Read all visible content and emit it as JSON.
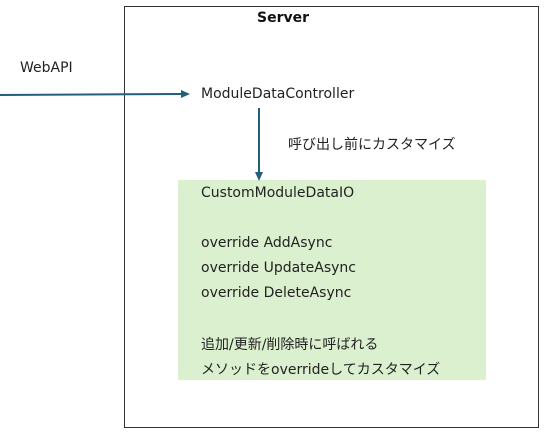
{
  "server": {
    "title": "Server"
  },
  "webapi": {
    "label": "WebAPI"
  },
  "controller": {
    "label": "ModuleDataController"
  },
  "customize_note": {
    "label": "呼び出し前にカスタマイズ"
  },
  "custom_box": {
    "class_name": "CustomModuleDataIO",
    "methods": [
      "override AddAsync",
      "override UpdateAsync",
      "override DeleteAsync"
    ],
    "description_lines": [
      "追加/更新/削除時に呼ばれる",
      "メソッドをoverrideしてカスタマイズ"
    ]
  },
  "colors": {
    "arrow": "#245f7a",
    "green_box": "#dbf0cf",
    "border": "#333333"
  }
}
